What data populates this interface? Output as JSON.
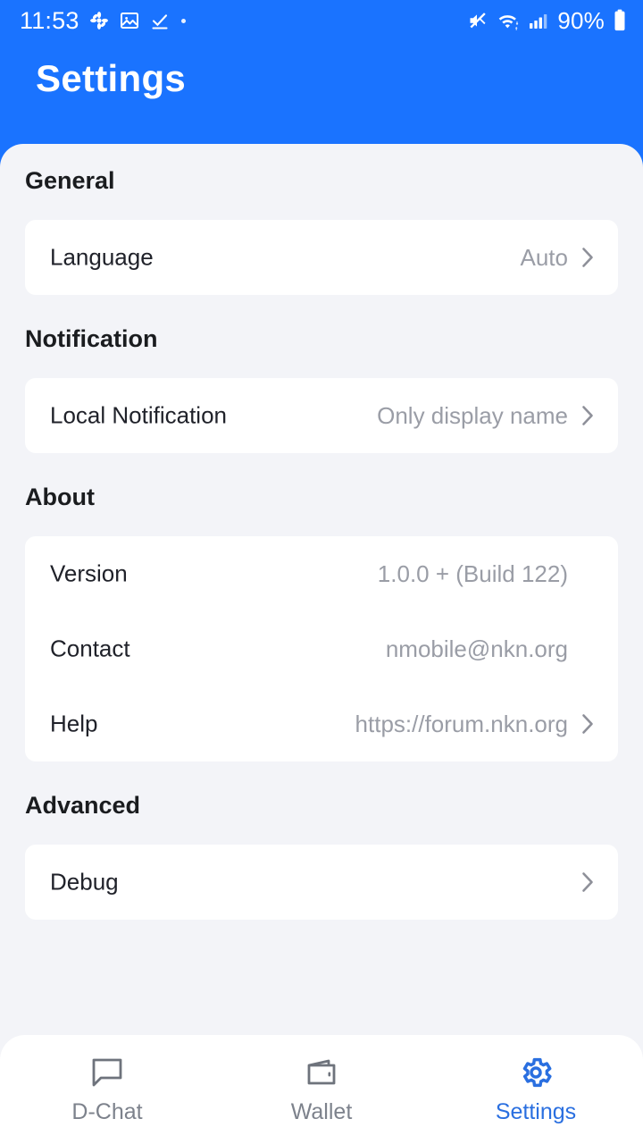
{
  "statusbar": {
    "time": "11:53",
    "battery_percent": "90%",
    "icons": [
      "flower-icon",
      "image-icon",
      "download-complete-icon",
      "dot-icon",
      "mute-icon",
      "wifi-icon",
      "signal-icon",
      "battery-icon"
    ]
  },
  "header": {
    "title": "Settings",
    "color": "#1A73FF"
  },
  "sections": [
    {
      "title": "General",
      "rows": [
        {
          "label": "Language",
          "value": "Auto",
          "chevron": true
        }
      ]
    },
    {
      "title": "Notification",
      "rows": [
        {
          "label": "Local Notification",
          "value": "Only display name",
          "chevron": true
        }
      ]
    },
    {
      "title": "About",
      "rows": [
        {
          "label": "Version",
          "value": "1.0.0 + (Build 122)",
          "chevron": false
        },
        {
          "label": "Contact",
          "value": "nmobile@nkn.org",
          "chevron": false
        },
        {
          "label": "Help",
          "value": "https://forum.nkn.org",
          "chevron": true
        }
      ]
    },
    {
      "title": "Advanced",
      "rows": [
        {
          "label": "Debug",
          "value": "",
          "chevron": true
        }
      ]
    }
  ],
  "bottomnav": {
    "active_index": 2,
    "accent": "#2A6FE0",
    "inactive": "#7D828C",
    "items": [
      {
        "label": "D-Chat",
        "icon": "chat-bubble-icon"
      },
      {
        "label": "Wallet",
        "icon": "wallet-icon"
      },
      {
        "label": "Settings",
        "icon": "gear-icon"
      }
    ]
  }
}
